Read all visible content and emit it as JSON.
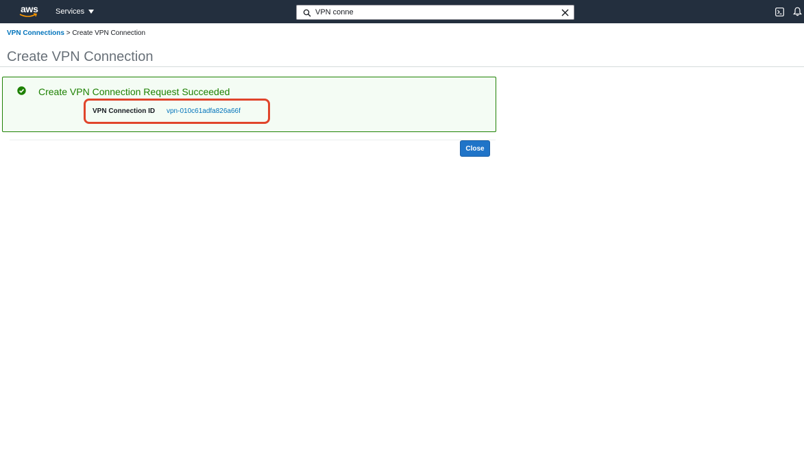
{
  "nav": {
    "logo_text": "aws",
    "services_label": "Services",
    "search_value": "VPN conne"
  },
  "breadcrumb": {
    "parent": "VPN Connections",
    "separator": ">",
    "current": "Create VPN Connection"
  },
  "page": {
    "title": "Create VPN Connection"
  },
  "result": {
    "message": "Create VPN Connection Request Succeeded",
    "id_label": "VPN Connection ID",
    "id_value": "vpn-010c61adfa826a66f"
  },
  "actions": {
    "close_label": "Close"
  },
  "colors": {
    "nav_bg": "#232f3e",
    "success_green": "#1d8102",
    "link_blue": "#0073bb",
    "primary_button": "#2074c8",
    "highlight_red": "#e0452b"
  }
}
